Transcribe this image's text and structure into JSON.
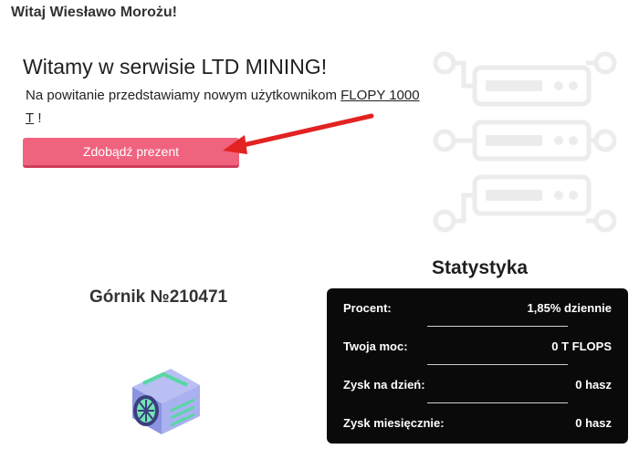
{
  "header": {
    "greeting": "Witaj Wiesławo Morożu!"
  },
  "welcome": {
    "title": "Witamy w serwisie LTD MINING!",
    "text_before": "Na powitanie przedstawiamy nowym użytkownikom ",
    "link_text": "FLOPY 1000 T",
    "text_after": " !",
    "button_label": "Zdobądź prezent"
  },
  "miner": {
    "title": "Górnik №210471"
  },
  "stats": {
    "title": "Statystyka",
    "rows": [
      {
        "label": "Procent:",
        "value": "1,85% dziennie"
      },
      {
        "label": "Twoja moc:",
        "value": "0 T FLOPS"
      },
      {
        "label": "Zysk na dzień:",
        "value": "0 hasz"
      },
      {
        "label": "Zysk miesięcznie:",
        "value": "0 hasz"
      }
    ]
  },
  "colors": {
    "accent": "#f0637f",
    "arrow": "#e32222",
    "panel": "#0a0a0a"
  }
}
